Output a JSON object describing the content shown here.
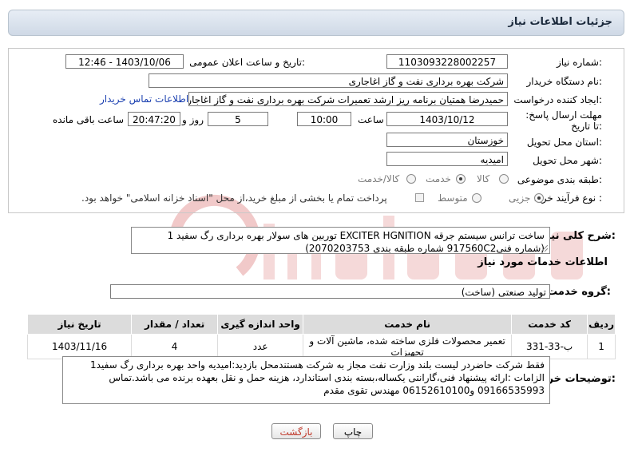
{
  "title": "جزئیات اطلاعات نیاز",
  "form": {
    "need_number": {
      "label": "شماره نیاز:",
      "value": "1103093228002257"
    },
    "announce_datetime": {
      "label": "تاریخ و ساعت اعلان عمومی:",
      "value": "1403/10/06 - 12:46"
    },
    "buyer_org": {
      "label": "نام دستگاه خریدار:",
      "value": "شرکت بهره برداری نفت و گاز اغاجاری"
    },
    "creator": {
      "label": "ایجاد کننده درخواست:",
      "value": "حمیدرضا همتیان برنامه ریز ارشد تعمیرات شرکت بهره برداری نفت و گاز اغاجاری",
      "link": "اطلاعات تماس خریدار"
    },
    "deadline": {
      "label": "مهلت ارسال پاسخ: تا تاریخ:",
      "date": "1403/10/12",
      "time_label": "ساعت",
      "time": "10:00",
      "days": "5",
      "days_label": "روز و",
      "remaining": "20:47:20",
      "remaining_label": "ساعت باقی مانده"
    },
    "province": {
      "label": "استان محل تحویل:",
      "value": "خوزستان"
    },
    "city": {
      "label": "شهر محل تحویل:",
      "value": "امیدیه"
    },
    "category": {
      "label": "طبقه بندی موضوعی:",
      "options": [
        "کالا",
        "خدمت",
        "کالا/خدمت"
      ],
      "selected": "خدمت"
    },
    "purchase_type": {
      "label": "نوع فرآیند خرید :",
      "options": [
        "جزیی",
        "متوسط"
      ],
      "selected": "جزیی",
      "note": "پرداخت تمام یا بخشی از مبلغ خرید،از محل \"اسناد خزانه اسلامی\" خواهد بود."
    }
  },
  "need_description": {
    "label": "شرح کلی نیاز:",
    "value": "ساخت ترانس سیستم جرقه EXCITER HGNITION توربین های سولار بهره برداری رگ سفید 1 (شماره فنی917560C2  شماره طبقه بندی 2070203753)"
  },
  "services_info_label": "اطلاعات خدمات مورد نیاز",
  "service_group": {
    "label": "گروه خدمت:",
    "value": "تولید صنعتی (ساخت)"
  },
  "table": {
    "headers": [
      "ردیف",
      "کد خدمت",
      "نام خدمت",
      "واحد اندازه گیری",
      "تعداد / مقدار",
      "تاریخ نیاز"
    ],
    "rows": [
      [
        "1",
        "ب-33-331",
        "تعمیر محصولات فلزی ساخته شده، ماشین آلات و تجهیزات",
        "عدد",
        "4",
        "1403/11/16"
      ]
    ]
  },
  "buyer_notes": {
    "label": "توضیحات خریدار:",
    "value": "فقط شرکت حاضردر لیست بلند وزارت نفت مجاز به شرکت هستندمحل بازدید:امیدیه واحد بهره برداری رگ سفید1 الزامات :ارائه پیشنهاد فنی،گارانتی یکساله،بسته بندی استاندارد، هزینه حمل و نقل بعهده برنده می باشد.تماس 09166535993 و06152610100 مهندس تقوی مقدم"
  },
  "buttons": {
    "print": "چاپ",
    "back": "بازگشت"
  },
  "colors": {
    "back_button_text": "#c0392b",
    "link": "#1a3fb0",
    "header_bg": "#dcdcdc"
  }
}
